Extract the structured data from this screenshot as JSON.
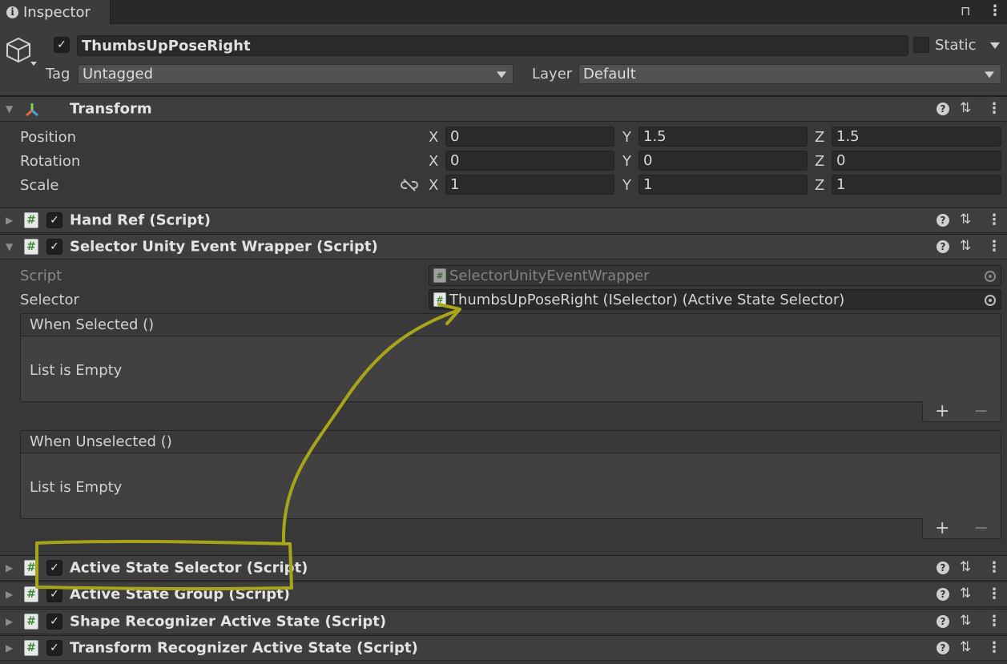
{
  "tab": {
    "title": "Inspector"
  },
  "object": {
    "name": "ThumbsUpPoseRight",
    "static_label": "Static",
    "tag_label": "Tag",
    "tag_value": "Untagged",
    "layer_label": "Layer",
    "layer_value": "Default"
  },
  "transform": {
    "title": "Transform",
    "rows": [
      {
        "label": "Position",
        "x": "0",
        "y": "1.5",
        "z": "1.5"
      },
      {
        "label": "Rotation",
        "x": "0",
        "y": "0",
        "z": "0"
      },
      {
        "label": "Scale",
        "x": "1",
        "y": "1",
        "z": "1"
      }
    ],
    "axis_x": "X",
    "axis_y": "Y",
    "axis_z": "Z"
  },
  "components": {
    "hand_ref": "Hand Ref (Script)",
    "selector_wrapper": "Selector Unity Event Wrapper (Script)",
    "active_state_selector": "Active State Selector (Script)",
    "active_state_group": "Active State Group (Script)",
    "shape_recognizer": "Shape Recognizer Active State (Script)",
    "transform_recognizer": "Transform Recognizer Active State (Script)"
  },
  "wrapper": {
    "script_label": "Script",
    "script_value": "SelectorUnityEventWrapper",
    "selector_label": "Selector",
    "selector_value": "ThumbsUpPoseRight (ISelector) (Active State Selector)",
    "when_selected": "When Selected ()",
    "when_unselected": "When Unselected ()",
    "empty_text": "List is Empty",
    "add": "+",
    "remove": "−"
  },
  "annotation": {
    "color": "#a8a51a"
  }
}
